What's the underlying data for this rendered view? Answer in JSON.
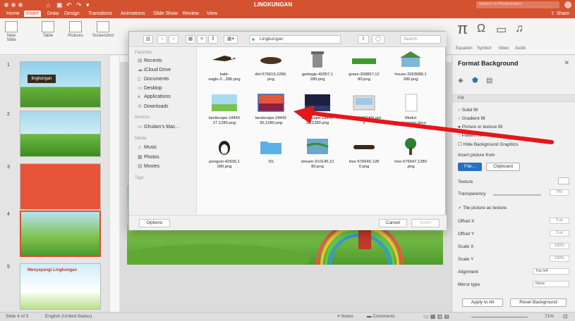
{
  "window": {
    "title": "LINGKUNGAN",
    "search_placeholder": "Search in Presentation",
    "share_label": "Share"
  },
  "ribbon_tabs": [
    "Home",
    "Insert",
    "Draw",
    "Design",
    "Transitions",
    "Animations",
    "Slide Show",
    "Review",
    "View"
  ],
  "ribbon_active_tab": "Insert",
  "ribbon": {
    "new_slide": "New Slide",
    "table": "Table",
    "pictures": "Pictures",
    "screenshot": "Screenshot",
    "equation": "Equation",
    "symbol": "Symbol",
    "video": "Video",
    "audio": "Audio"
  },
  "thumbnails": [
    {
      "num": "1",
      "text": "lingkungan"
    },
    {
      "num": "2",
      "text": ""
    },
    {
      "num": "3",
      "text": ""
    },
    {
      "num": "4",
      "text": ""
    },
    {
      "num": "5",
      "text": "Menyayangi Lingkungan"
    }
  ],
  "dialog": {
    "location": "Lingkungan",
    "search_placeholder": "Search",
    "favorites_head": "Favorites",
    "favorites": [
      "Recents",
      "iCloud Drive",
      "Documents",
      "Desktop",
      "Applications",
      "Downloads"
    ],
    "devices_head": "Devices",
    "devices": [
      "Ghulam's Mac..."
    ],
    "media_head": "Media",
    "media": [
      "Music",
      "Photos",
      "Movies"
    ],
    "tags_head": "Tags",
    "options_label": "Options",
    "cancel_label": "Cancel",
    "insert_label": "Insert",
    "files": [
      {
        "name": "bald-\neagle-2...280.png",
        "kind": "eagle"
      },
      {
        "name": "dirt-576619,1280.\npng",
        "kind": "dirt"
      },
      {
        "name": "garbage-40357,1\n280.png",
        "kind": "bin"
      },
      {
        "name": "grass-303857,12\n80.png",
        "kind": "grass"
      },
      {
        "name": "house-2003088,1\n280.png",
        "kind": "house"
      },
      {
        "name": "landscape-18442\n27,1280.png",
        "kind": "land1"
      },
      {
        "name": "landscape-18442\n30,1280.png",
        "kind": "land2"
      },
      {
        "name": "landscape-18442\n31,1280.png",
        "kind": "land3"
      },
      {
        "name": "LINGKUNGAN.ppt\nx",
        "kind": "pptx"
      },
      {
        "name": "Modul\nLingkungan.docx",
        "kind": "docx"
      },
      {
        "name": "penguin-42936,1\n280.png",
        "kind": "penguin"
      },
      {
        "name": "SS",
        "kind": "folder"
      },
      {
        "name": "stream-310145,12\n80.png",
        "kind": "stream"
      },
      {
        "name": "tree-576646,128\n0.png",
        "kind": "log"
      },
      {
        "name": "tree-576647,1280\n.png",
        "kind": "tree"
      }
    ]
  },
  "format_pane": {
    "title": "Format Background",
    "section_fill": "Fill",
    "options": [
      "Solid fill",
      "Gradient fill",
      "Picture or texture fill",
      "Pattern fill"
    ],
    "hide_graphics": "Hide Background Graphics",
    "insert_from": "Insert picture from",
    "file_btn": "File...",
    "clipboard_btn": "Clipboard",
    "texture": "Texture",
    "transparency": "Transparency",
    "transparency_val": "0%",
    "tile": "Tile picture as texture",
    "offset_x": "Offset X",
    "offset_x_val": "0 pt",
    "offset_y": "Offset Y",
    "offset_y_val": "0 pt",
    "scale_x": "Scale X",
    "scale_x_val": "100%",
    "scale_y": "Scale Y",
    "scale_y_val": "100%",
    "alignment": "Alignment",
    "alignment_val": "Top left",
    "mirror": "Mirror type",
    "mirror_val": "None",
    "apply_all": "Apply to All",
    "reset": "Reset Background"
  },
  "status": {
    "slide": "Slide 4 of 5",
    "language": "English (United States)",
    "notes": "Notes",
    "comments": "Comments",
    "zoom": "71%"
  },
  "colors": {
    "accent": "#d35230",
    "arrow": "#e5161a"
  }
}
